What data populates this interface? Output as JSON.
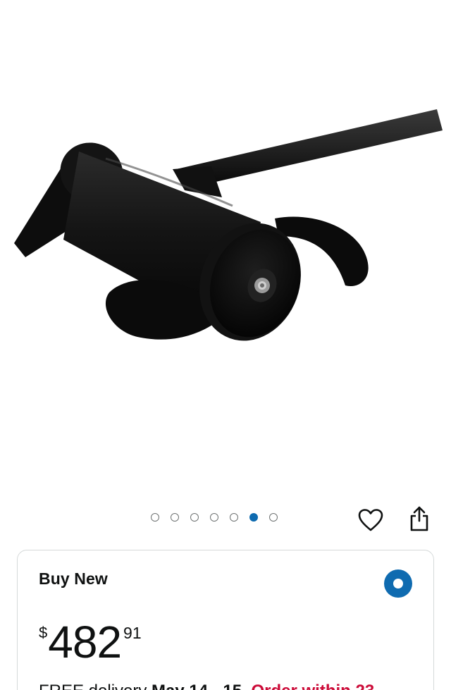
{
  "product": {
    "image_alt": "Black electric trolling motor propeller unit on a shaft",
    "carousel": {
      "total": 7,
      "active_index": 5
    }
  },
  "icons": {
    "wishlist": "heart-icon",
    "share": "share-icon"
  },
  "buy_box": {
    "title": "Buy New",
    "selected": true,
    "price": {
      "symbol": "$",
      "whole": "482",
      "fraction": "91"
    },
    "delivery": {
      "prefix": "FREE delivery ",
      "date": "May 14 - 15",
      "separator": ". ",
      "urgency": "Order within 23"
    }
  },
  "colors": {
    "accent_blue": "#0f6bb0",
    "urgent_red": "#cc0c39",
    "text": "#0f1111",
    "border": "#d5d9d9"
  }
}
